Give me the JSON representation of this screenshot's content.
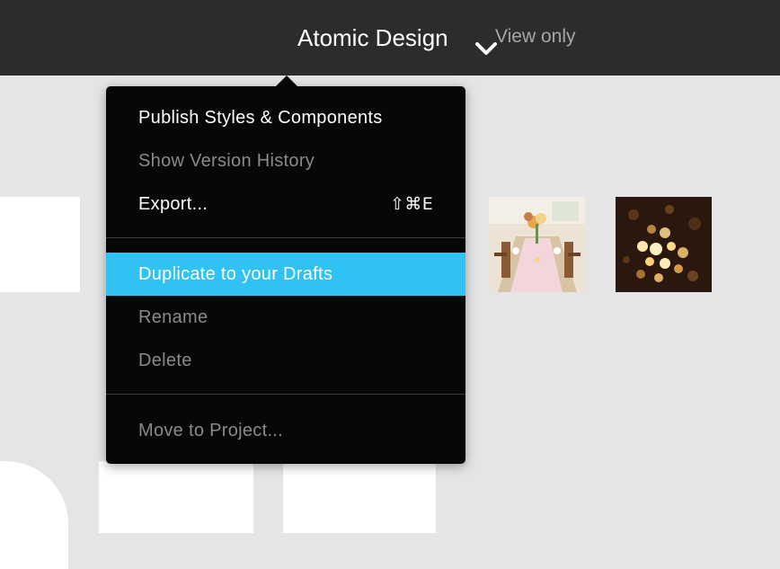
{
  "header": {
    "file_title": "Atomic Design",
    "title_menu_icon": "chevron-down-icon",
    "permission_label": "View only"
  },
  "menu": {
    "items": [
      {
        "label": "Publish Styles & Components",
        "enabled": true
      },
      {
        "label": "Show Version History",
        "enabled": false
      },
      {
        "label": "Export...",
        "enabled": true,
        "shortcut": "⇧⌘E"
      },
      {
        "label": "Duplicate to your Drafts",
        "enabled": true,
        "highlighted": true
      },
      {
        "label": "Rename",
        "enabled": false
      },
      {
        "label": "Delete",
        "enabled": false
      },
      {
        "label": "Move to Project...",
        "enabled": false
      }
    ]
  },
  "colors": {
    "topbar": "#2c2c2c",
    "canvas": "#e5e5e5",
    "menu_background": "#070707",
    "menu_highlight": "#30c2f2",
    "disabled_text": "#8a8a8a"
  }
}
